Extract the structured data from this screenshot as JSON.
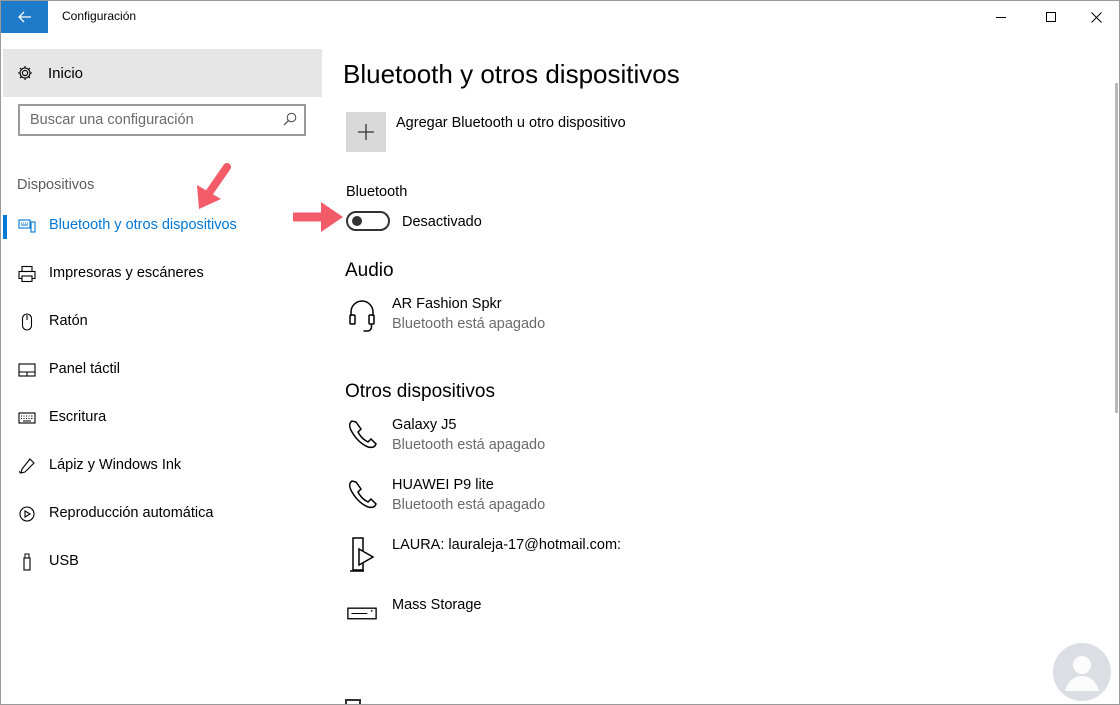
{
  "window": {
    "title": "Configuración",
    "back_icon": "back-arrow-icon",
    "accent": "#0078d7",
    "back_bg": "#1d7bc9"
  },
  "sidebar": {
    "home_label": "Inicio",
    "search_placeholder": "Buscar una configuración",
    "section_label": "Dispositivos",
    "items": [
      {
        "label": "Bluetooth y otros dispositivos",
        "icon": "bluetooth-devices-icon",
        "active": true
      },
      {
        "label": "Impresoras y escáneres",
        "icon": "printer-icon",
        "active": false
      },
      {
        "label": "Ratón",
        "icon": "mouse-icon",
        "active": false
      },
      {
        "label": "Panel táctil",
        "icon": "touchpad-icon",
        "active": false
      },
      {
        "label": "Escritura",
        "icon": "keyboard-icon",
        "active": false
      },
      {
        "label": "Lápiz y Windows Ink",
        "icon": "pen-icon",
        "active": false
      },
      {
        "label": "Reproducción automática",
        "icon": "autoplay-icon",
        "active": false
      },
      {
        "label": "USB",
        "icon": "usb-icon",
        "active": false
      }
    ]
  },
  "main": {
    "title": "Bluetooth y otros dispositivos",
    "add_label": "Agregar Bluetooth u otro dispositivo",
    "bluetooth_label": "Bluetooth",
    "bluetooth_state": "Desactivado",
    "audio_heading": "Audio",
    "audio_devices": [
      {
        "name": "AR Fashion Spkr",
        "status": "Bluetooth está apagado",
        "icon": "headset-icon"
      }
    ],
    "other_heading": "Otros dispositivos",
    "other_devices": [
      {
        "name": "Galaxy J5",
        "status": "Bluetooth está apagado",
        "icon": "phone-icon"
      },
      {
        "name": "HUAWEI P9 lite",
        "status": "Bluetooth está apagado",
        "icon": "phone-icon"
      },
      {
        "name": "LAURA: lauraleja-17@hotmail.com:",
        "status": "",
        "icon": "media-device-icon"
      },
      {
        "name": "Mass Storage",
        "status": "",
        "icon": "drive-icon"
      }
    ]
  },
  "annotation_color": "#f45b69"
}
